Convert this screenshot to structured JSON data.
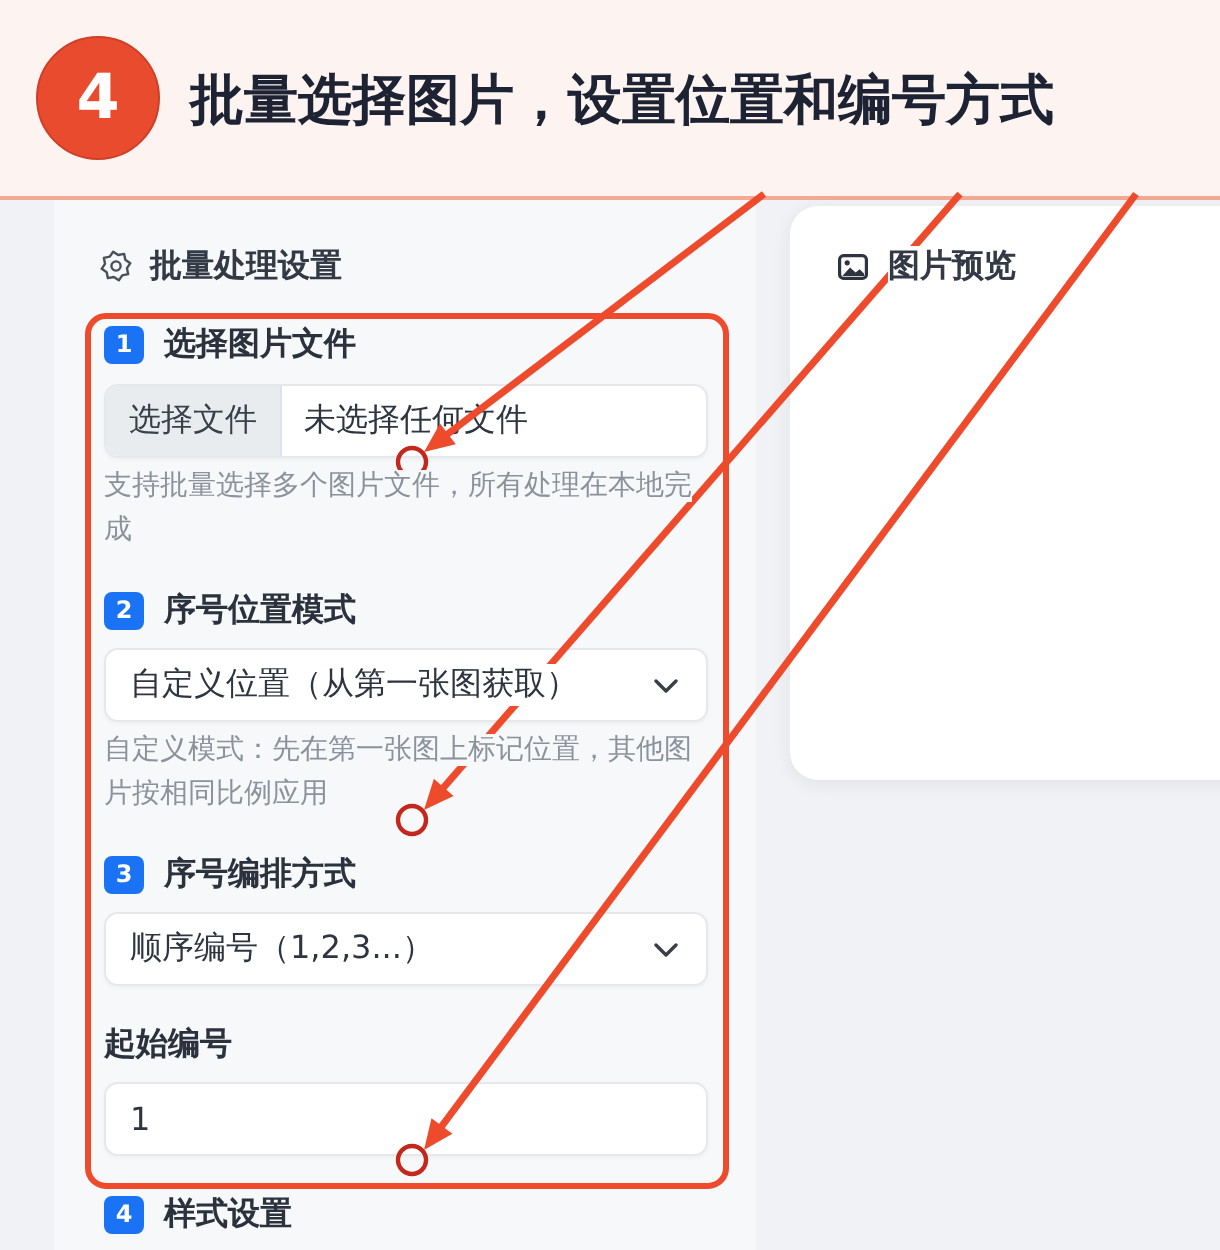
{
  "header": {
    "step": "4",
    "title": "批量选择图片，设置位置和编号方式"
  },
  "settings_panel": {
    "title": "批量处理设置",
    "highlight_box": {
      "on": true,
      "sections": [
        {
          "kind": "file",
          "badge": "1",
          "label": "选择图片文件",
          "button": "选择文件",
          "status": "未选择任何文件",
          "hint": "支持批量选择多个图片文件，所有处理在本地完成",
          "arrow": true
        },
        {
          "kind": "select",
          "badge": "2",
          "label": "序号位置模式",
          "value": "自定义位置（从第一张图获取）",
          "hint": "自定义模式：先在第一张图上标记位置，其他图片按相同比例应用",
          "arrow": true
        },
        {
          "kind": "select",
          "badge": "3",
          "label": "序号编排方式",
          "value": "顺序编号（1,2,3...）",
          "arrow": false
        },
        {
          "kind": "number",
          "label": "起始编号",
          "value": "1",
          "arrow": true
        }
      ]
    },
    "next_section": {
      "badge": "4",
      "label": "样式设置"
    }
  },
  "preview_panel": {
    "title": "图片预览"
  }
}
